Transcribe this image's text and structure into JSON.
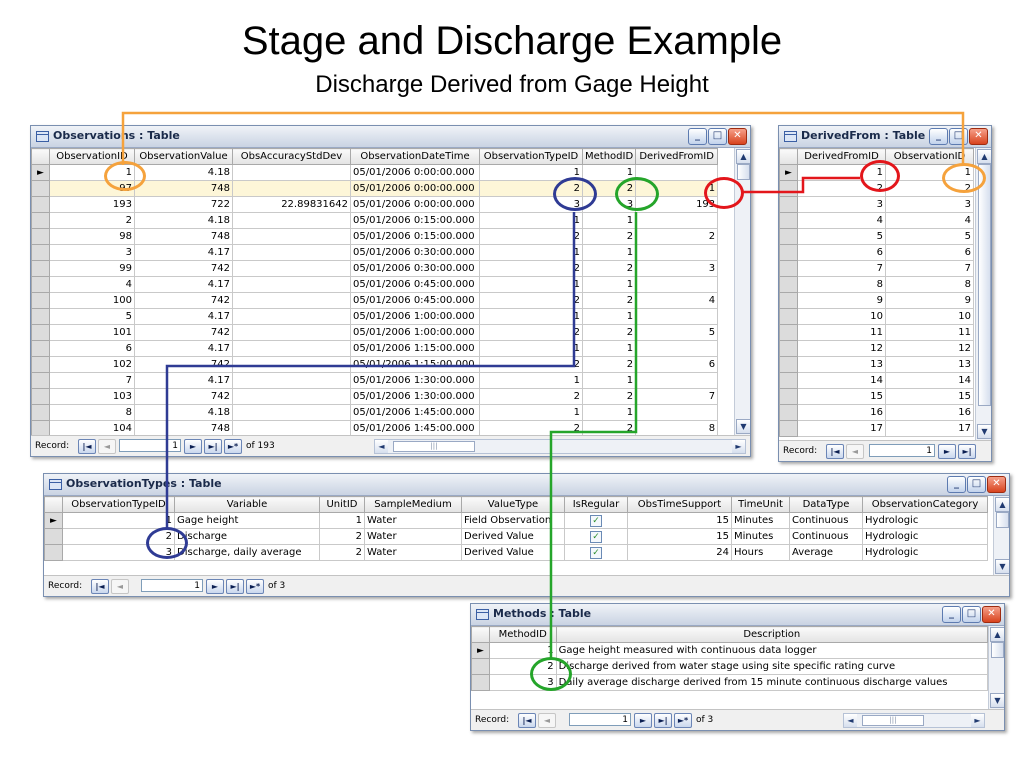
{
  "title": "Stage and Discharge Example",
  "subtitle": "Discharge Derived from Gage Height",
  "windows": {
    "observations": {
      "title": "Observations : Table",
      "columns": [
        "ObservationID",
        "ObservationValue",
        "ObsAccuracyStdDev",
        "ObservationDateTime",
        "ObservationTypeID",
        "MethodID",
        "DerivedFromID"
      ],
      "rows": [
        [
          "1",
          "4.18",
          "",
          "05/01/2006 0:00:00.000",
          "1",
          "1",
          ""
        ],
        [
          "97",
          "748",
          "",
          "05/01/2006 0:00:00.000",
          "2",
          "2",
          "1"
        ],
        [
          "193",
          "722",
          "22.89831642",
          "05/01/2006 0:00:00.000",
          "3",
          "3",
          "193"
        ],
        [
          "2",
          "4.18",
          "",
          "05/01/2006 0:15:00.000",
          "1",
          "1",
          ""
        ],
        [
          "98",
          "748",
          "",
          "05/01/2006 0:15:00.000",
          "2",
          "2",
          "2"
        ],
        [
          "3",
          "4.17",
          "",
          "05/01/2006 0:30:00.000",
          "1",
          "1",
          ""
        ],
        [
          "99",
          "742",
          "",
          "05/01/2006 0:30:00.000",
          "2",
          "2",
          "3"
        ],
        [
          "4",
          "4.17",
          "",
          "05/01/2006 0:45:00.000",
          "1",
          "1",
          ""
        ],
        [
          "100",
          "742",
          "",
          "05/01/2006 0:45:00.000",
          "2",
          "2",
          "4"
        ],
        [
          "5",
          "4.17",
          "",
          "05/01/2006 1:00:00.000",
          "1",
          "1",
          ""
        ],
        [
          "101",
          "742",
          "",
          "05/01/2006 1:00:00.000",
          "2",
          "2",
          "5"
        ],
        [
          "6",
          "4.17",
          "",
          "05/01/2006 1:15:00.000",
          "1",
          "1",
          ""
        ],
        [
          "102",
          "742",
          "",
          "05/01/2006 1:15:00.000",
          "2",
          "2",
          "6"
        ],
        [
          "7",
          "4.17",
          "",
          "05/01/2006 1:30:00.000",
          "1",
          "1",
          ""
        ],
        [
          "103",
          "742",
          "",
          "05/01/2006 1:30:00.000",
          "2",
          "2",
          "7"
        ],
        [
          "8",
          "4.18",
          "",
          "05/01/2006 1:45:00.000",
          "1",
          "1",
          ""
        ],
        [
          "104",
          "748",
          "",
          "05/01/2006 1:45:00.000",
          "2",
          "2",
          "8"
        ]
      ],
      "nav": {
        "label": "Record:",
        "current": "1",
        "of_text": "of 193"
      }
    },
    "derived_from": {
      "title": "DerivedFrom : Table",
      "columns": [
        "DerivedFromID",
        "ObservationID"
      ],
      "rows": [
        [
          "1",
          "1"
        ],
        [
          "2",
          "2"
        ],
        [
          "3",
          "3"
        ],
        [
          "4",
          "4"
        ],
        [
          "5",
          "5"
        ],
        [
          "6",
          "6"
        ],
        [
          "7",
          "7"
        ],
        [
          "8",
          "8"
        ],
        [
          "9",
          "9"
        ],
        [
          "10",
          "10"
        ],
        [
          "11",
          "11"
        ],
        [
          "12",
          "12"
        ],
        [
          "13",
          "13"
        ],
        [
          "14",
          "14"
        ],
        [
          "15",
          "15"
        ],
        [
          "16",
          "16"
        ],
        [
          "17",
          "17"
        ]
      ],
      "nav": {
        "label": "Record:",
        "current": "1"
      }
    },
    "observation_types": {
      "title": "ObservationTypes : Table",
      "columns": [
        "ObservationTypeID",
        "Variable",
        "UnitID",
        "SampleMedium",
        "ValueType",
        "IsRegular",
        "ObsTimeSupport",
        "TimeUnit",
        "DataType",
        "ObservationCategory"
      ],
      "rows": [
        [
          "1",
          "Gage height",
          "1",
          "Water",
          "Field Observation",
          "✓",
          "15",
          "Minutes",
          "Continuous",
          "Hydrologic"
        ],
        [
          "2",
          "Discharge",
          "2",
          "Water",
          "Derived Value",
          "✓",
          "15",
          "Minutes",
          "Continuous",
          "Hydrologic"
        ],
        [
          "3",
          "Discharge, daily average",
          "2",
          "Water",
          "Derived Value",
          "✓",
          "24",
          "Hours",
          "Average",
          "Hydrologic"
        ]
      ],
      "nav": {
        "label": "Record:",
        "current": "1",
        "of_text": "of 3"
      }
    },
    "methods": {
      "title": "Methods : Table",
      "columns": [
        "MethodID",
        "Description"
      ],
      "rows": [
        [
          "1",
          "Gage height measured with continuous data logger"
        ],
        [
          "2",
          "Discharge derived from water stage using site specific rating curve"
        ],
        [
          "3",
          "Daily average discharge derived from 15 minute continuous discharge values"
        ]
      ],
      "nav": {
        "label": "Record:",
        "current": "1",
        "of_text": "of 3"
      }
    }
  },
  "nav_glyphs": {
    "first": "|◄",
    "prev": "◄",
    "next": "►",
    "last": "►|",
    "new": "►*"
  },
  "window_controls": {
    "minimize": "_",
    "maximize": "□",
    "close": "✕"
  },
  "colors": {
    "orange": "#f5a23c",
    "blue": "#2f3b94",
    "green": "#25a52a",
    "red": "#e3161b",
    "highlight_row": "#fdf6d8"
  },
  "icons": [
    "table-icon",
    "record-selector-icon",
    "checkbox-checked-icon",
    "scroll-up-arrow-icon",
    "scroll-down-arrow-icon"
  ]
}
